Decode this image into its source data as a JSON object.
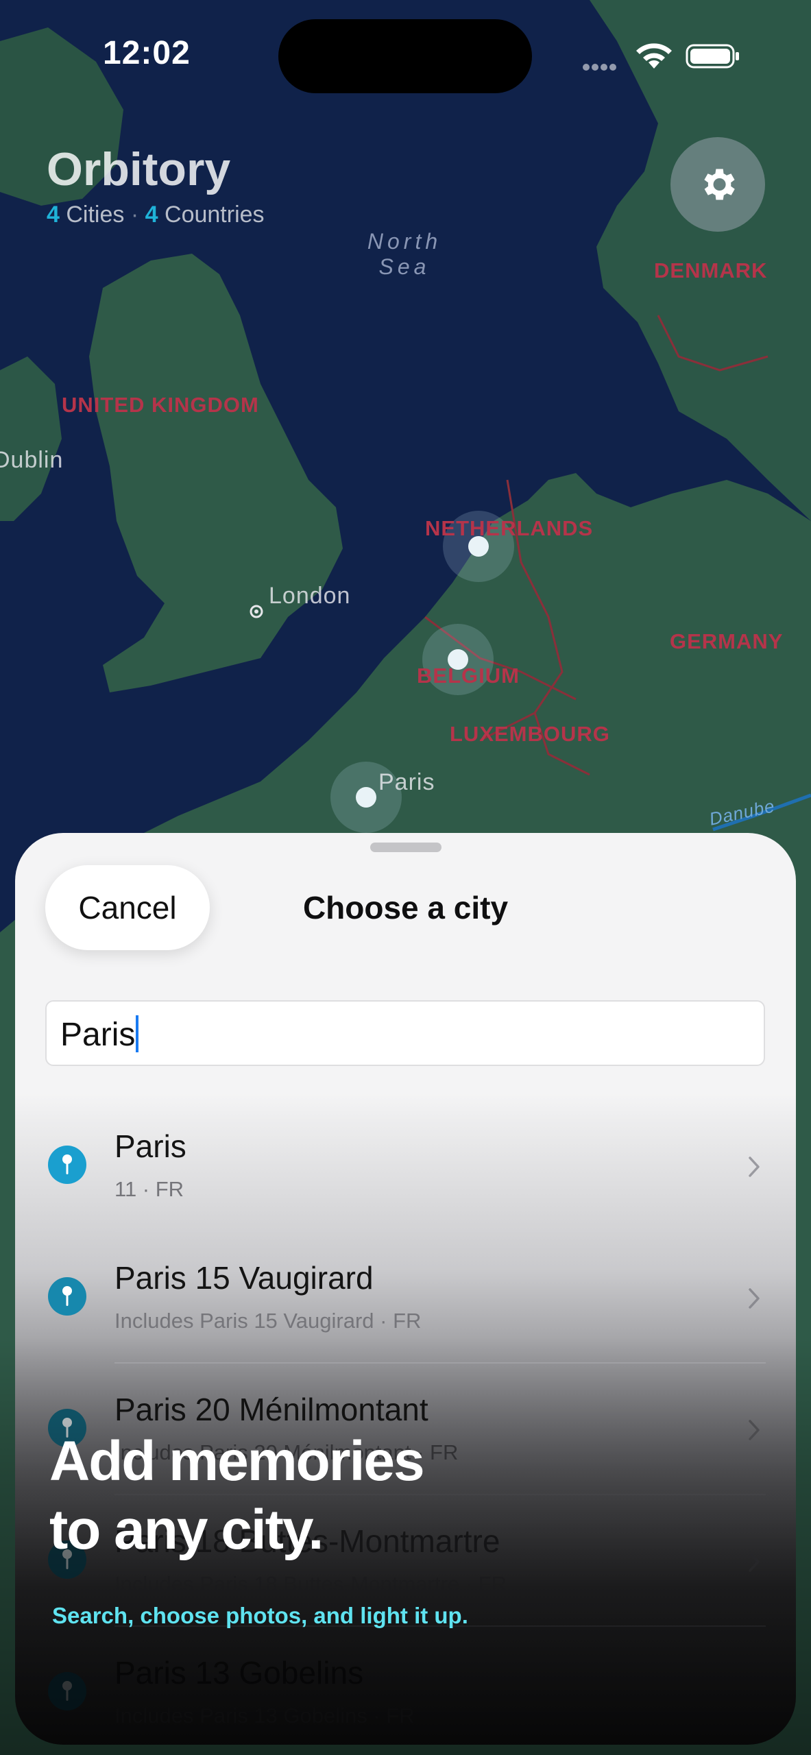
{
  "status_bar": {
    "time": "12:02"
  },
  "header": {
    "app_title": "Orbitory",
    "city_count": "4",
    "city_word": "Cities",
    "separator": "·",
    "country_count": "4",
    "country_word": "Countries"
  },
  "map": {
    "countries": [
      "DENMARK",
      "UNITED KINGDOM",
      "NETHERLANDS",
      "GERMANY",
      "BELGIUM",
      "LUXEMBOURG"
    ],
    "sea_label": [
      "North",
      "Sea"
    ],
    "cities": [
      "Dublin",
      "London",
      "Paris"
    ],
    "river": "Danube"
  },
  "sheet": {
    "cancel_label": "Cancel",
    "title": "Choose a city",
    "search_value": "Paris",
    "results": [
      {
        "title": "Paris",
        "subtitle": "11 · FR"
      },
      {
        "title": "Paris 15 Vaugirard",
        "subtitle": "Includes Paris 15 Vaugirard · FR"
      },
      {
        "title": "Paris 20 Ménilmontant",
        "subtitle": "Includes Paris 20 Ménilmontant · FR"
      },
      {
        "title": "Paris 18 Buttes-Montmartre",
        "subtitle": "Includes Paris 18 Buttes-Montmartre · FR"
      },
      {
        "title": "Paris 13 Gobelins",
        "subtitle": "Includes Paris 13 Gobelins · FR"
      }
    ]
  },
  "promo": {
    "title_line1": "Add memories",
    "title_line2": "to any city.",
    "subtitle": "Search, choose photos, and light it up."
  },
  "colors": {
    "accent": "#1fb2d8",
    "country_label": "#b5344a",
    "promo_subtitle": "#5fe3f0",
    "caret": "#1a7bf2"
  },
  "icons": {
    "settings": "gear-icon",
    "result_pin": "pin-icon",
    "row_chevron": "chevron-right-icon"
  }
}
